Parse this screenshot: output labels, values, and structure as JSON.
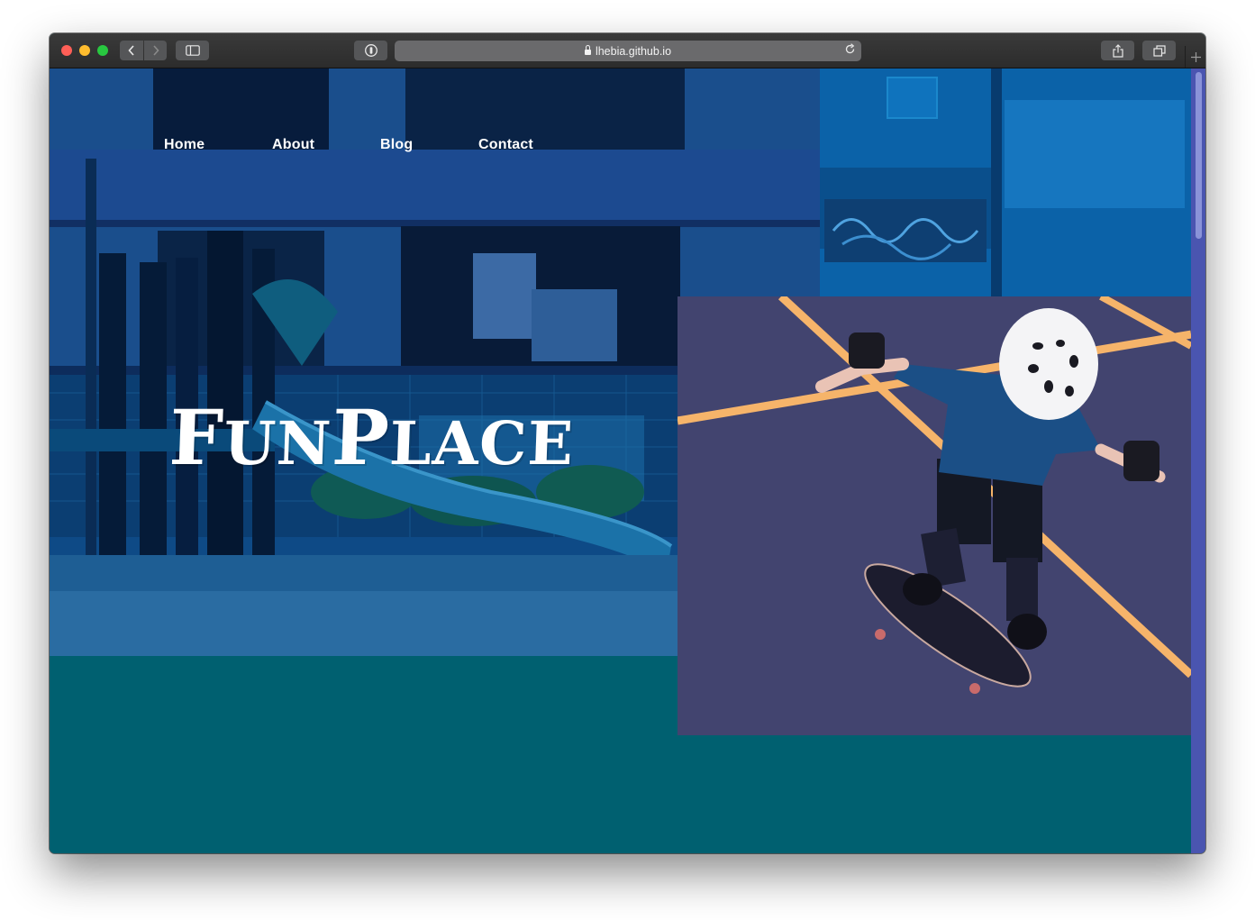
{
  "browser": {
    "url": "lhebia.github.io",
    "back_icon": "chevron-left-icon",
    "forward_icon": "chevron-right-icon"
  },
  "nav": {
    "items": [
      "Home",
      "About",
      "Blog",
      "Contact"
    ]
  },
  "brand": {
    "first": "F",
    "second": "UN",
    "third": "P",
    "fourth": "LACE"
  },
  "colors": {
    "page_bg": "#006070",
    "hero_tint": "#0d3f78",
    "photo_tint": "#3f4175",
    "court_line": "#f6b46a"
  }
}
